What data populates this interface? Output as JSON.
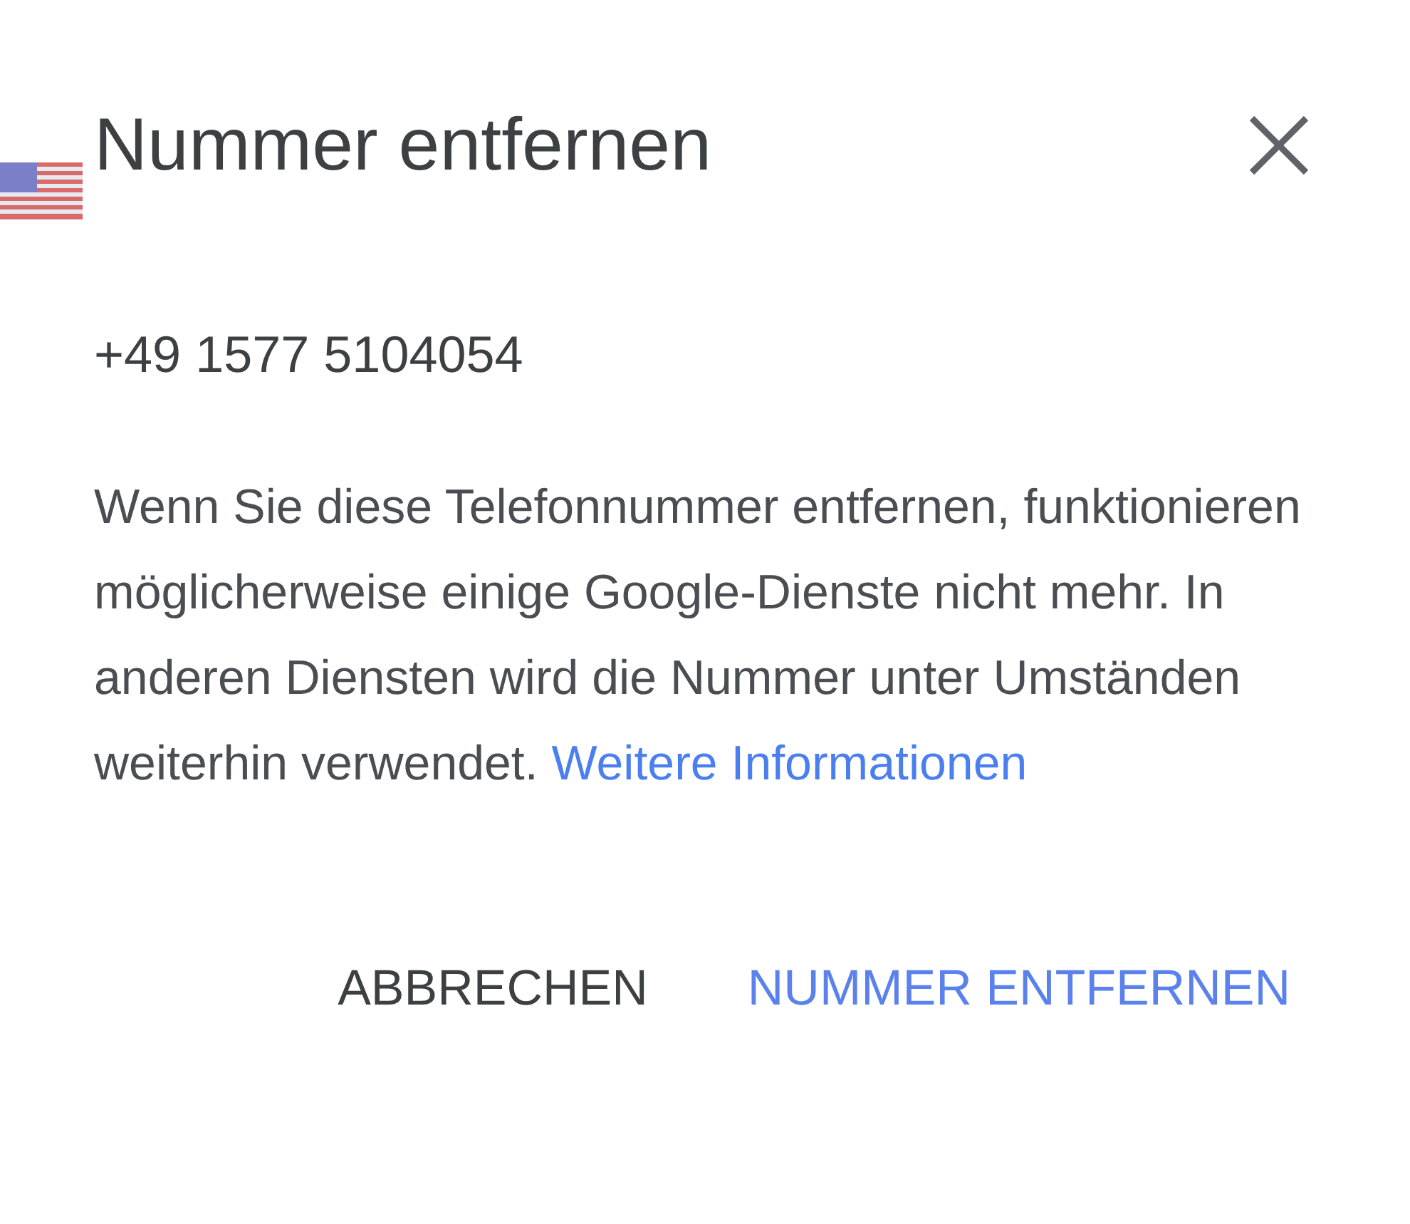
{
  "dialog": {
    "title": "Nummer entfernen",
    "phone_number": "+49 1577 5104054",
    "message": "Wenn Sie diese Telefonnummer entfernen, funktionieren möglicherweise einige Google-Dienste nicht mehr. In anderen Diensten wird die Nummer unter Umständen weiterhin verwendet.",
    "link": "Weitere Informationen",
    "buttons": [
      {
        "label": "ABBRECHEN",
        "kind": "secondary"
      },
      {
        "label": "NUMMER ENTFERNEN",
        "kind": "primary"
      }
    ]
  }
}
